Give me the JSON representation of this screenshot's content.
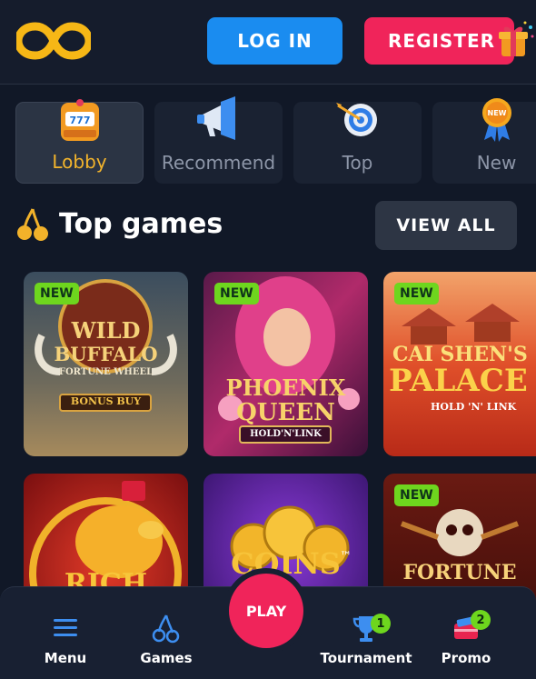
{
  "header": {
    "login_label": "LOG IN",
    "register_label": "REGISTER",
    "logo_icon": "infinity-logo-icon",
    "gift_icon": "gift-icon"
  },
  "categories": [
    {
      "label": "Lobby",
      "icon": "slot-machine-icon",
      "active": true
    },
    {
      "label": "Recommend",
      "icon": "megaphone-icon",
      "active": false
    },
    {
      "label": "Top",
      "icon": "target-icon",
      "active": false
    },
    {
      "label": "New",
      "icon": "new-medal-icon",
      "active": false
    }
  ],
  "section": {
    "title": "Top games",
    "view_all_label": "VIEW ALL",
    "icon": "cherry-icon"
  },
  "games": [
    {
      "badge": "NEW",
      "line1": "WILD",
      "line2": "BUFFALO",
      "line3": "FORTUNE WHEEL",
      "line4": "BONUS BUY"
    },
    {
      "badge": "NEW",
      "line1": "PHOENIX",
      "line2": "QUEEN",
      "line3": "HOLD'N'LINK"
    },
    {
      "badge": "NEW",
      "line1": "CAI SHEN'S",
      "line2": "PALACE",
      "line3": "HOLD 'N' LINK"
    },
    {
      "line1": "RICH"
    },
    {
      "line1": "COINS",
      "tm": "™"
    },
    {
      "badge": "NEW",
      "line1": "FORTUNE"
    }
  ],
  "bottom_nav": {
    "menu_label": "Menu",
    "games_label": "Games",
    "play_label": "PLAY",
    "tournament_label": "Tournament",
    "tournament_count": "1",
    "promo_label": "Promo",
    "promo_count": "2"
  },
  "colors": {
    "background": "#111827",
    "login_blue": "#1a8cf0",
    "register_pink": "#f0245a",
    "badge_green": "#6ed61e",
    "active_gold": "#f3b42c"
  }
}
